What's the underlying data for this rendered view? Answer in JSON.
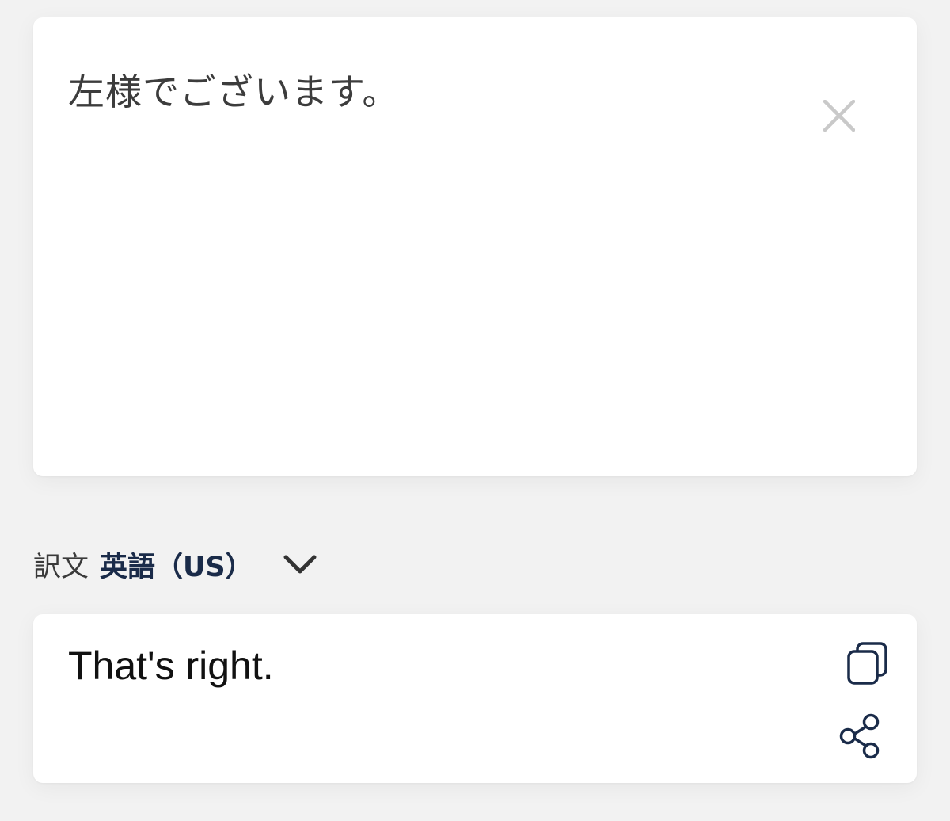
{
  "source": {
    "text": "左様でございます。",
    "clear_icon": "close-icon"
  },
  "target_language": {
    "prefix": "訳文",
    "language": "英語（US）",
    "dropdown_icon": "chevron-down-icon"
  },
  "result": {
    "text": "That's right.",
    "copy_icon": "copy-icon",
    "share_icon": "share-icon"
  },
  "colors": {
    "background": "#f2f2f2",
    "card": "#ffffff",
    "language_accent": "#1a2b49",
    "icon_dark": "#1a2b49",
    "clear_icon": "#c9c9c9"
  }
}
